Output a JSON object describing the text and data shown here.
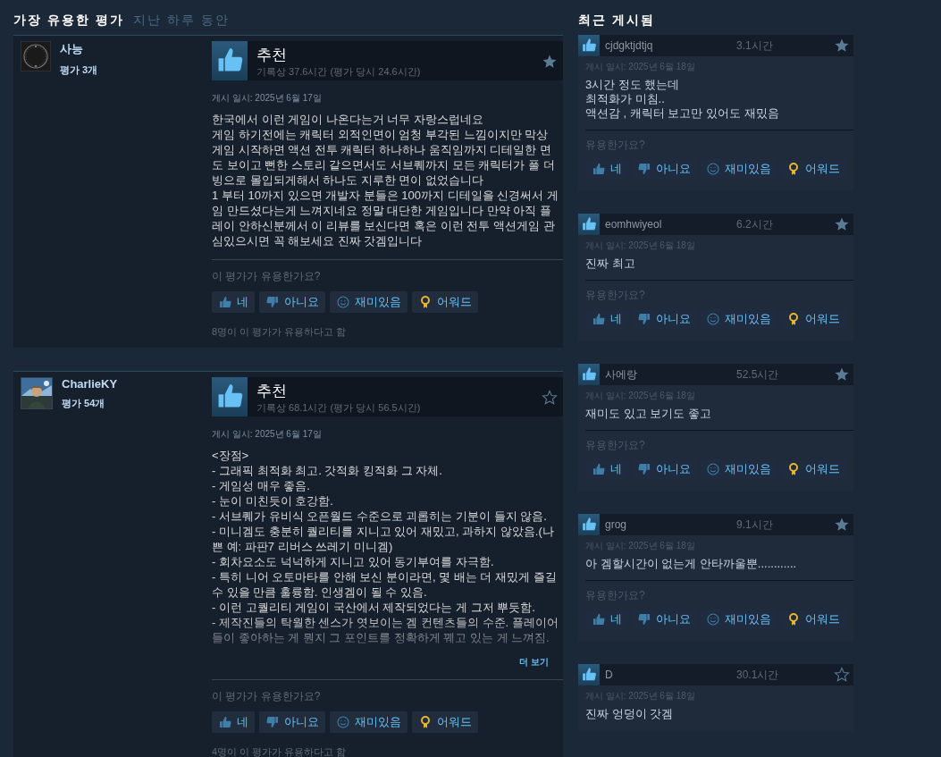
{
  "most_helpful": {
    "title": "가장 유용한 평가",
    "period": "지난 하루 동안",
    "reviews": [
      {
        "author": "사능",
        "avatar": {
          "kind": "emblem"
        },
        "review_count": "평가 3개",
        "verdict": "추천",
        "hours": "기록상 37.6시간 (평가 당시 24.6시간)",
        "starred": true,
        "posted": "게시 일시: 2025년 6월 17일",
        "text": "한국에서 이런 게임이 나온다는거 너무 자랑스럽네요\n게임 하기전에는 캐릭터 외적인면이 엄청 부각된 느낌이지만 막상 게임 시작하면 액션 전투 캐릭터 하나하나 움직임까지 디테일한 면도 보이고 뻔한 스토리 같으면서도 서브퀘까지 모든 캐릭터가 풀 더빙으로 몰입되게해서 하나도 지루한 면이 없었습니다\n1 부터 10까지 있으면 개발자 분들은 100까지 디테일을 신경써서 게임 만드셨다는게 느껴지네요 정말 대단한 게임입니다 만약 아직 플레이 안하신분께서 이 리뷰를 보신다면 혹은 이런 전투 액션게임 관심있으시면 꼭 해보세요 진짜 갓겜입니다",
        "faded": false,
        "helpful_prompt": "이 평가가 유용한가요?",
        "buttons": [
          {
            "kind": "yes",
            "label": "네"
          },
          {
            "kind": "no",
            "label": "아니요"
          },
          {
            "kind": "funny",
            "label": "재미있음"
          },
          {
            "kind": "award",
            "label": "어워드"
          }
        ],
        "helpful_count": "8명이 이 평가가 유용하다고 함"
      },
      {
        "author": "CharlieKY",
        "avatar": {
          "kind": "picture"
        },
        "review_count": "평가 54개",
        "verdict": "추천",
        "hours": "기록상 68.1시간 (평가 당시 56.5시간)",
        "starred": false,
        "posted": "게시 일시: 2025년 6월 17일",
        "text": "<장점>\n- 그래픽 최적화 최고. 갓적화 킹적화 그 자체.\n- 게임성 매우 좋음.\n- 눈이 미친듯이 호강함.\n- 서브퀘가 유비식 오픈월드 수준으로 괴롭히는 기분이 들지 않음.\n- 미니겜도 충분히 퀄리티를 지니고 있어 재밌고, 과하지 않았음.(나쁜 예: 파판7 리버스 쓰레기 미니겜)\n- 회차요소도 넉넉하게 지니고 있어 동기부여를 자극함.\n- 특히 니어 오토마타를 안해 보신 분이라면, 몇 배는 더 재밌게 즐길 수 있을 만큼 훌륭함. 인생겜이 될 수 있음.\n- 이런 고퀄리티 게임이 국산에서 제작되었다는 게 그저 뿌듯함.\n- 제작진들의 탁월한 센스가 엿보이는 겜 컨텐츠들의 수준. 플레이어들이 좋아하는 게 뭔지 그 포인트를 정확하게 꿰고 있는 게 느껴짐.",
        "faded": true,
        "read_more": "더 보기",
        "helpful_prompt": "이 평가가 유용한가요?",
        "buttons": [
          {
            "kind": "yes",
            "label": "네"
          },
          {
            "kind": "no",
            "label": "아니요"
          },
          {
            "kind": "funny",
            "label": "재미있음"
          },
          {
            "kind": "award",
            "label": "어워드"
          }
        ],
        "helpful_count": "4명이 이 평가가 유용하다고 함"
      }
    ]
  },
  "recent": {
    "title": "최근 게시됨",
    "reviews": [
      {
        "author": "cjdgktjdtjq",
        "hours": "3.1시간",
        "starred": true,
        "posted": "게시 일시: 2025년 6월 18일",
        "text": "3시간 정도 했는데\n최적화가 미침..\n액션감 , 캐릭터 보고만 있어도 재밌음",
        "helpful_prompt": "유용한가요?",
        "buttons": [
          {
            "kind": "yes",
            "label": "네"
          },
          {
            "kind": "no",
            "label": "아니요"
          },
          {
            "kind": "funny",
            "label": "재미있음"
          },
          {
            "kind": "award",
            "label": "어워드"
          }
        ]
      },
      {
        "author": "eomhwiyeol",
        "hours": "6.2시간",
        "starred": true,
        "posted": "게시 일시: 2025년 6월 18일",
        "text": "진짜 최고",
        "helpful_prompt": "유용한가요?",
        "buttons": [
          {
            "kind": "yes",
            "label": "네"
          },
          {
            "kind": "no",
            "label": "아니요"
          },
          {
            "kind": "funny",
            "label": "재미있음"
          },
          {
            "kind": "award",
            "label": "어워드"
          }
        ]
      },
      {
        "author": "사에랑",
        "hours": "52.5시간",
        "starred": true,
        "posted": "게시 일시: 2025년 6월 18일",
        "text": "재미도 있고 보기도 좋고",
        "helpful_prompt": "유용한가요?",
        "buttons": [
          {
            "kind": "yes",
            "label": "네"
          },
          {
            "kind": "no",
            "label": "아니요"
          },
          {
            "kind": "funny",
            "label": "재미있음"
          },
          {
            "kind": "award",
            "label": "어워드"
          }
        ]
      },
      {
        "author": "grog",
        "hours": "9.1시간",
        "starred": true,
        "posted": "게시 일시: 2025년 6월 18일",
        "text": "아 겜할시간이 없는게 안타까울뿐............",
        "helpful_prompt": "유용한가요?",
        "buttons": [
          {
            "kind": "yes",
            "label": "네"
          },
          {
            "kind": "no",
            "label": "아니요"
          },
          {
            "kind": "funny",
            "label": "재미있음"
          },
          {
            "kind": "award",
            "label": "어워드"
          }
        ]
      },
      {
        "author": "D",
        "hours": "30.1시간",
        "starred": false,
        "posted": "게시 일시: 2025년 6월 18일",
        "text": "진짜 엉덩이 갓겜"
      }
    ]
  }
}
